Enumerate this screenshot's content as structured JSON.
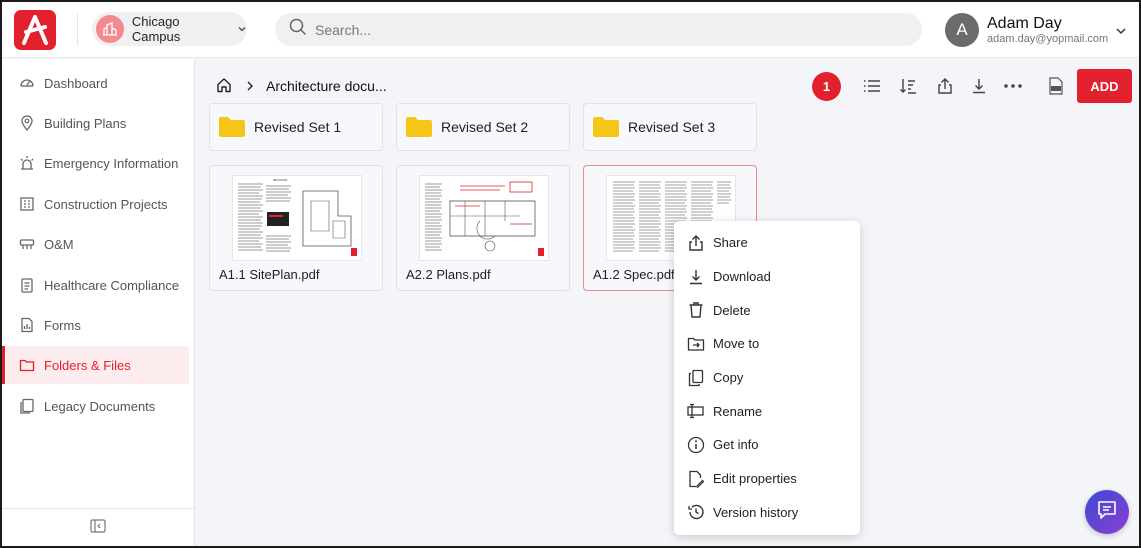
{
  "header": {
    "campus": "Chicago Campus",
    "search_placeholder": "Search...",
    "user_initial": "A",
    "user_name": "Adam Day",
    "user_email": "adam.day@yopmail.com"
  },
  "sidebar": {
    "items": [
      {
        "label": "Dashboard",
        "icon": "gauge-icon"
      },
      {
        "label": "Building Plans",
        "icon": "map-pin-icon"
      },
      {
        "label": "Emergency Information",
        "icon": "alarm-icon"
      },
      {
        "label": "Construction Projects",
        "icon": "building-icon"
      },
      {
        "label": "O&M",
        "icon": "tools-icon"
      },
      {
        "label": "Healthcare Compliance",
        "icon": "clipboard-icon"
      },
      {
        "label": "Forms",
        "icon": "form-icon"
      },
      {
        "label": "Folders & Files",
        "icon": "folder-icon",
        "active": true
      },
      {
        "label": "Legacy Documents",
        "icon": "documents-icon"
      }
    ]
  },
  "toolbar": {
    "breadcrumb": "Architecture docu...",
    "selected_count": "1",
    "add_label": "ADD"
  },
  "folders": [
    "Revised Set 1",
    "Revised Set 2",
    "Revised Set 3"
  ],
  "files": [
    "A1.1 SitePlan.pdf",
    "A2.2 Plans.pdf",
    "A1.2 Spec.pdf"
  ],
  "context_menu": [
    "Share",
    "Download",
    "Delete",
    "Move to",
    "Copy",
    "Rename",
    "Get info",
    "Edit properties",
    "Version history"
  ],
  "colors": {
    "accent": "#e3202d",
    "folder": "#f5c518"
  }
}
